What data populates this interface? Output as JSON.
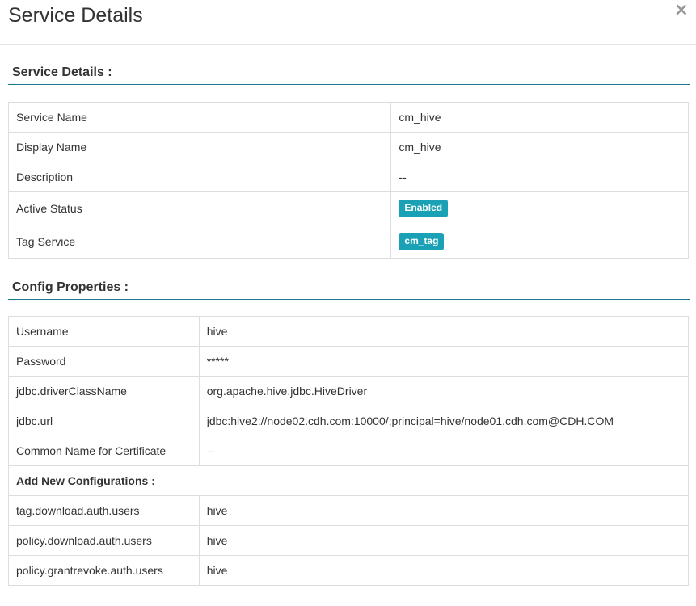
{
  "modal": {
    "title": "Service Details",
    "close_glyph": "×"
  },
  "service_details": {
    "heading": "Service Details :",
    "rows": [
      {
        "label": "Service Name",
        "value": "cm_hive"
      },
      {
        "label": "Display Name",
        "value": "cm_hive"
      },
      {
        "label": "Description",
        "value": "--"
      },
      {
        "label": "Active Status",
        "badge": "Enabled"
      },
      {
        "label": "Tag Service",
        "badge": "cm_tag"
      }
    ]
  },
  "config_properties": {
    "heading": "Config Properties :",
    "rows": [
      {
        "label": "Username",
        "value": "hive"
      },
      {
        "label": "Password",
        "value": "*****"
      },
      {
        "label": "jdbc.driverClassName",
        "value": "org.apache.hive.jdbc.HiveDriver"
      },
      {
        "label": "jdbc.url",
        "value": "jdbc:hive2://node02.cdh.com:10000/;principal=hive/node01.cdh.com@CDH.COM"
      },
      {
        "label": "Common Name for Certificate",
        "value": "--"
      }
    ],
    "add_new_heading": "Add New Configurations :",
    "custom_rows": [
      {
        "label": "tag.download.auth.users",
        "value": "hive"
      },
      {
        "label": "policy.download.auth.users",
        "value": "hive"
      },
      {
        "label": "policy.grantrevoke.auth.users",
        "value": "hive"
      }
    ]
  },
  "colors": {
    "badge": "#1ba1b5",
    "section_rule": "#1d7a8c",
    "border": "#dddddd"
  }
}
